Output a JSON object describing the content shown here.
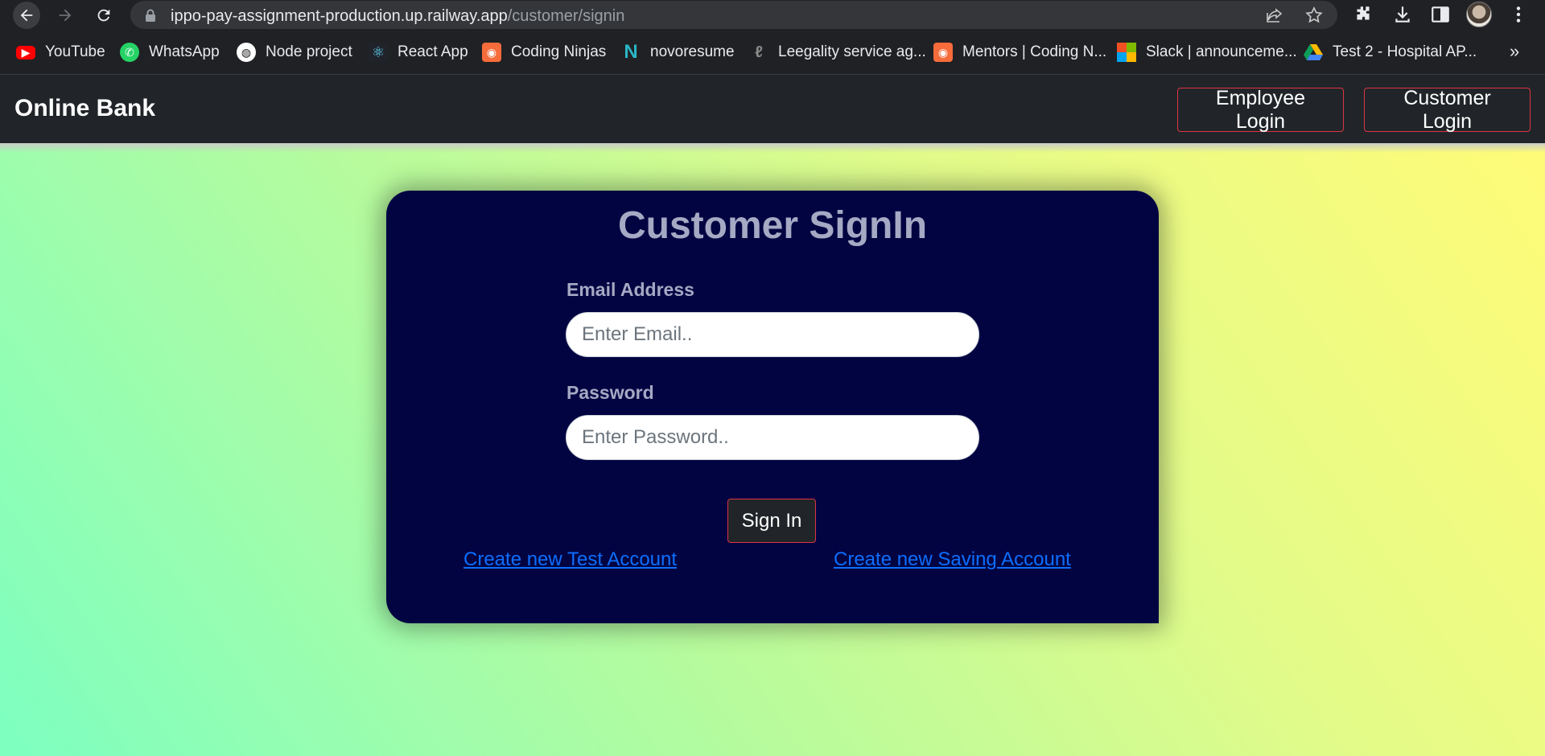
{
  "browser": {
    "url_host": "ippo-pay-assignment-production.up.railway.app",
    "url_path": "/customer/signin",
    "bookmarks": [
      {
        "label": "YouTube",
        "icon": "youtube-icon",
        "color": "#ff0000"
      },
      {
        "label": "WhatsApp",
        "icon": "whatsapp-icon",
        "color": "#25d366"
      },
      {
        "label": "Node project",
        "icon": "globe-icon",
        "color": "#ffffff"
      },
      {
        "label": "React App",
        "icon": "react-icon",
        "color": "#61dafb"
      },
      {
        "label": "Coding Ninjas",
        "icon": "coding-ninjas-icon",
        "color": "#f66c3b"
      },
      {
        "label": "novoresume",
        "icon": "novoresume-icon",
        "color": "#29b6c6"
      },
      {
        "label": "Leegality service ag...",
        "icon": "leegality-icon",
        "color": "#888888"
      },
      {
        "label": "Mentors | Coding N...",
        "icon": "coding-ninjas-icon",
        "color": "#f66c3b"
      },
      {
        "label": "Slack | announceme...",
        "icon": "microsoft-icon",
        "color": "#f25022"
      },
      {
        "label": "Test 2 - Hospital AP...",
        "icon": "google-drive-icon",
        "color": "#1fa463"
      }
    ],
    "more_label": "»"
  },
  "navbar": {
    "brand": "Online Bank",
    "employee_login": "Employee Login",
    "customer_login": "Customer Login"
  },
  "signin": {
    "title": "Customer SignIn",
    "email_label": "Email Address",
    "email_placeholder": "Enter Email..",
    "email_value": "",
    "password_label": "Password",
    "password_placeholder": "Enter Password..",
    "password_value": "",
    "submit_label": "Sign In",
    "create_test_link": "Create new Test Account",
    "create_saving_link": "Create new Saving Account"
  },
  "colors": {
    "card_bg": "#020442",
    "accent_border": "#dc3545",
    "link": "#0d6efd",
    "navbar_bg": "#212529"
  }
}
